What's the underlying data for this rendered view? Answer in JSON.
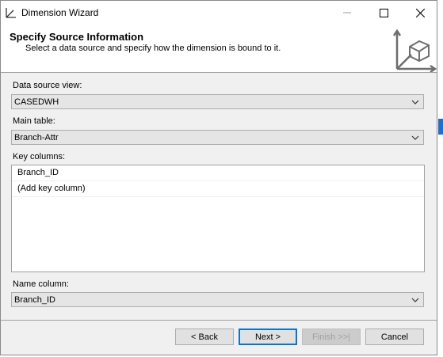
{
  "window": {
    "title": "Dimension Wizard"
  },
  "header": {
    "title": "Specify Source Information",
    "subtitle": "Select a data source and specify how the dimension is bound to it."
  },
  "data_source_view": {
    "label": "Data source view:",
    "value": "CASEDWH"
  },
  "main_table": {
    "label": "Main table:",
    "value": "Branch-Attr"
  },
  "key_columns": {
    "label": "Key columns:",
    "rows": [
      "Branch_ID",
      "(Add key column)"
    ]
  },
  "name_column": {
    "label": "Name column:",
    "value": "Branch_ID"
  },
  "buttons": {
    "back": "< Back",
    "next": "Next >",
    "finish": "Finish >>|",
    "cancel": "Cancel"
  },
  "icons": {
    "app": "wizard-icon",
    "header": "dimension-cube-icon"
  }
}
